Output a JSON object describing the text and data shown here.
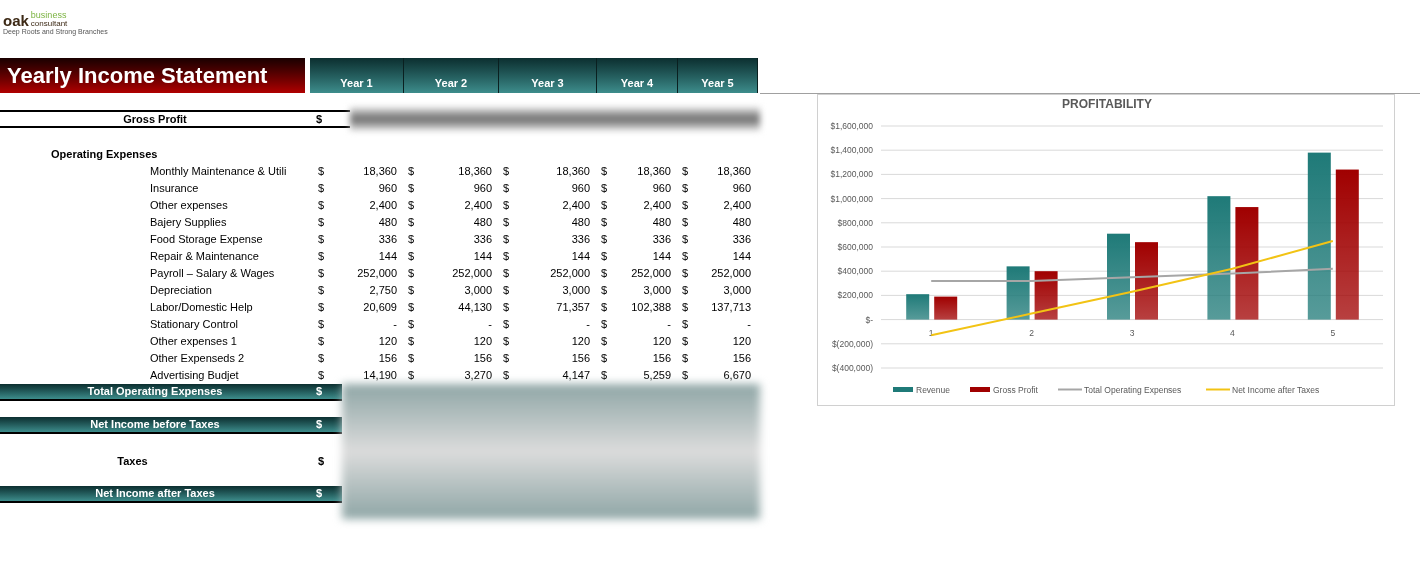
{
  "logo": {
    "brand": "oak",
    "line_1": "business",
    "line_2": "consultant",
    "tagline": "Deep Roots and Strong Branches"
  },
  "title": "Yearly Income Statement",
  "columns": [
    "Year 1",
    "Year 2",
    "Year 3",
    "Year 4",
    "Year 5"
  ],
  "gross_profit": {
    "label": "Gross Profit",
    "currency": "$"
  },
  "section": "Operating Expenses",
  "expenses": [
    {
      "label": "Monthly Maintenance & Utili",
      "currency": "$",
      "cells": [
        [
          "18,360"
        ],
        [
          "$",
          "18,360"
        ],
        [
          "$",
          "18,360"
        ],
        [
          "$",
          "18,360"
        ],
        [
          "$",
          "18,360"
        ]
      ]
    },
    {
      "label": "Insurance",
      "currency": "$",
      "cells": [
        [
          "960"
        ],
        [
          "$",
          "960"
        ],
        [
          "$",
          "960"
        ],
        [
          "$",
          "960"
        ],
        [
          "$",
          "960"
        ]
      ]
    },
    {
      "label": "Other expenses",
      "currency": "$",
      "cells": [
        [
          "2,400"
        ],
        [
          "$",
          "2,400"
        ],
        [
          "$",
          "2,400"
        ],
        [
          "$",
          "2,400"
        ],
        [
          "$",
          "2,400"
        ]
      ]
    },
    {
      "label": "Bajery Supplies",
      "currency": "$",
      "cells": [
        [
          "480"
        ],
        [
          "$",
          "480"
        ],
        [
          "$",
          "480"
        ],
        [
          "$",
          "480"
        ],
        [
          "$",
          "480"
        ]
      ]
    },
    {
      "label": "Food Storage Expense",
      "currency": "$",
      "cells": [
        [
          "336"
        ],
        [
          "$",
          "336"
        ],
        [
          "$",
          "336"
        ],
        [
          "$",
          "336"
        ],
        [
          "$",
          "336"
        ]
      ]
    },
    {
      "label": "Repair & Maintenance",
      "currency": "$",
      "cells": [
        [
          "144"
        ],
        [
          "$",
          "144"
        ],
        [
          "$",
          "144"
        ],
        [
          "$",
          "144"
        ],
        [
          "$",
          "144"
        ]
      ]
    },
    {
      "label": "Payroll – Salary & Wages",
      "currency": "$",
      "cells": [
        [
          "252,000"
        ],
        [
          "$",
          "252,000"
        ],
        [
          "$",
          "252,000"
        ],
        [
          "$",
          "252,000"
        ],
        [
          "$",
          "252,000"
        ]
      ]
    },
    {
      "label": "Depreciation",
      "currency": "$",
      "cells": [
        [
          "2,750"
        ],
        [
          "$",
          "3,000"
        ],
        [
          "$",
          "3,000"
        ],
        [
          "$",
          "3,000"
        ],
        [
          "$",
          "3,000"
        ]
      ]
    },
    {
      "label": "Labor/Domestic Help",
      "currency": "$",
      "cells": [
        [
          "20,609"
        ],
        [
          "$",
          "44,130"
        ],
        [
          "$",
          "71,357"
        ],
        [
          "$",
          "102,388"
        ],
        [
          "$",
          "137,713"
        ]
      ]
    },
    {
      "label": "Stationary Control",
      "currency": "$",
      "cells": [
        [
          "-"
        ],
        [
          "$",
          "-"
        ],
        [
          "$",
          "-"
        ],
        [
          "$",
          "-"
        ],
        [
          "$",
          "-"
        ]
      ]
    },
    {
      "label": "Other expenses 1",
      "currency": "$",
      "cells": [
        [
          "120"
        ],
        [
          "$",
          "120"
        ],
        [
          "$",
          "120"
        ],
        [
          "$",
          "120"
        ],
        [
          "$",
          "120"
        ]
      ]
    },
    {
      "label": "Other Expenseds 2",
      "currency": "$",
      "cells": [
        [
          "156"
        ],
        [
          "$",
          "156"
        ],
        [
          "$",
          "156"
        ],
        [
          "$",
          "156"
        ],
        [
          "$",
          "156"
        ]
      ]
    },
    {
      "label": "Advertising Budjet",
      "currency": "$",
      "cells": [
        [
          "14,190"
        ],
        [
          "$",
          "3,270"
        ],
        [
          "$",
          "4,147"
        ],
        [
          "$",
          "5,259"
        ],
        [
          "$",
          "6,670"
        ]
      ]
    }
  ],
  "totals": [
    {
      "label": "Total Operating Expenses",
      "currency": "$",
      "kind": "band"
    },
    {
      "label": "Net Income before Taxes",
      "currency": "$",
      "kind": "band"
    },
    {
      "label": "Taxes",
      "currency": "$",
      "kind": "plain"
    },
    {
      "label": "Net Income after Taxes",
      "currency": "$",
      "kind": "band"
    }
  ],
  "chart": {
    "chart_data": {
      "type": "bar",
      "title": "PROFITABILITY",
      "categories": [
        "1",
        "2",
        "3",
        "4",
        "5"
      ],
      "stacked": false,
      "grid": true,
      "legend": "bottom",
      "ylim": [
        -400000,
        1600000
      ],
      "yticks": [
        {
          "value": -400000,
          "label": "$(400,000)"
        },
        {
          "value": -200000,
          "label": "$(200,000)"
        },
        {
          "value": 0,
          "label": "$-"
        },
        {
          "value": 200000,
          "label": "$200,000"
        },
        {
          "value": 400000,
          "label": "$400,000"
        },
        {
          "value": 600000,
          "label": "$600,000"
        },
        {
          "value": 800000,
          "label": "$800,000"
        },
        {
          "value": 1000000,
          "label": "$1,000,000"
        },
        {
          "value": 1200000,
          "label": "$1,200,000"
        },
        {
          "value": 1400000,
          "label": "$1,400,000"
        },
        {
          "value": 1600000,
          "label": "$1,600,000"
        }
      ],
      "series": [
        {
          "name": "Revenue",
          "color": "#1f7a78",
          "type": "bar",
          "values": [
            210000,
            440000,
            710000,
            1020000,
            1380000
          ]
        },
        {
          "name": "Gross Profit",
          "color": "#a00000",
          "type": "bar",
          "values": [
            190000,
            400000,
            640000,
            930000,
            1240000
          ]
        },
        {
          "name": "Total Operating Expenses",
          "color": "#a6a6a6",
          "type": "line",
          "values": [
            320000,
            320000,
            350000,
            380000,
            420000
          ]
        },
        {
          "name": "Net Income after Taxes",
          "color": "#f2c314",
          "type": "line",
          "values": [
            -130000,
            50000,
            230000,
            420000,
            650000
          ]
        }
      ]
    }
  }
}
